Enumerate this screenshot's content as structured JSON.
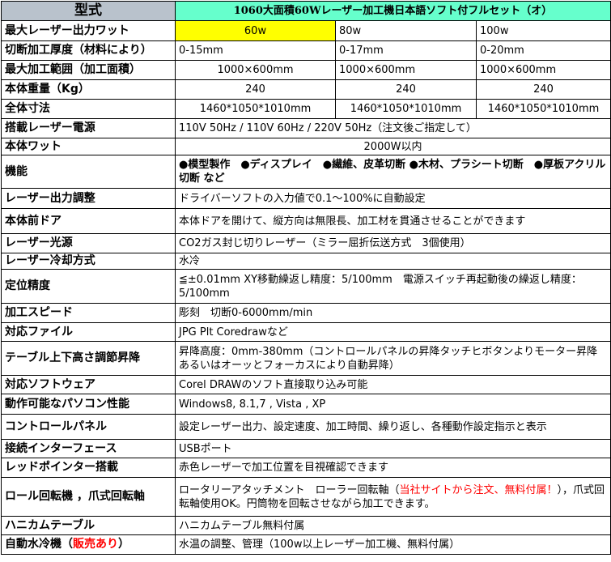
{
  "header": {
    "label": "型式",
    "title": "1060大面積60Wレーザー加工機日本語ソフト付フルセット（オ）"
  },
  "rows": {
    "power": {
      "label": "最大レーザー出力ワット",
      "v1": "60w",
      "v2": "80w",
      "v3": "100w"
    },
    "thickness": {
      "label": "切断加工厚度（材料により）",
      "v1": "0-15mm",
      "v2": "0-17mm",
      "v3": "0-20mm"
    },
    "area": {
      "label": "最大加工範囲（加工面積）",
      "v1": "1000×600mm",
      "v2": "1000×600mm",
      "v3": "1000×600mm"
    },
    "weight": {
      "label": "本体重量（Kg）",
      "v1": "240",
      "v2": "240",
      "v3": "240"
    },
    "size": {
      "label": "全体寸法",
      "v1": "1460*1050*1010mm",
      "v2": "1460*1050*1010mm",
      "v3": "1460*1050*1010mm"
    },
    "supply": {
      "label": "搭載レーザー電源",
      "value": "110V 50Hz / 110V 60Hz  / 220V 50Hz（注文後ご指定して）"
    },
    "wattage": {
      "label": "本体ワット",
      "value": "2000W以内"
    },
    "function": {
      "label": "機能",
      "value": "●模型製作　●ディスプレイ　●繊維、皮革切断 ●木材、プラシート切断　●厚板アクリル切断 など"
    },
    "adjust": {
      "label": "レーザー出力調整",
      "value": "ドライバーソフトの入力値で0.1～100%に自動設定"
    },
    "door": {
      "label": "本体前ドア",
      "value": "本体ドアを開けて、縦方向は無限長、加工材を貫通させることができます"
    },
    "source": {
      "label": "レーザー光源",
      "value": "CO2ガス封じ切りレーザー（ミラー屈折伝送方式　3個使用）"
    },
    "cooling": {
      "label": "レーザー冷却方式",
      "value": "水冷"
    },
    "precision": {
      "label": "定位精度",
      "value": "≦±0.01mm XY移動繰返し精度：5/100mm　電源スイッチ再起動後の繰返し精度：5/100mm"
    },
    "speed": {
      "label": "加工スピード",
      "value": "彫刻　切断0-6000mm/min"
    },
    "files": {
      "label": "対応ファイル",
      "value": "JPG  Plt  Coredrawなど"
    },
    "lift": {
      "label": "テーブル上下高さ調節昇降",
      "value": "昇降高度：0mm-380mm（コントロールパネルの昇降タッチヒボタンよりモーター昇降あるいはオーッとフォーカスにより自動昇降）"
    },
    "software": {
      "label": "対応ソフトウェア",
      "value": "Corel DRAWのソフト直接取り込み可能"
    },
    "pc": {
      "label": "動作可能なパソコン性能",
      "value": "Windows8, 8.1,7 , Vista , XP"
    },
    "panel": {
      "label": "コントロールパネル",
      "value": "設定レーザー出力、設定速度、加工時間、繰り返し、各種動作設定指示と表示"
    },
    "interface": {
      "label": "接続インターフェース",
      "value": "USBポート"
    },
    "pointer": {
      "label": "レッドポインター搭載",
      "value": "赤色レーザーで加工位置を目視確認できます"
    },
    "rotary": {
      "label": "ロール回転機 ，爪式回転軸",
      "value_a": "ロータリーアタッチメント　ローラー回転軸（",
      "value_red": "当社サイトから注文、無料付属！",
      "value_b": "），爪式回転軸使用OK。円筒物を回転させながら加工できます。"
    },
    "honeycomb": {
      "label": "ハニカムテーブル",
      "value": "ハニカムテーブル無料付属"
    },
    "chiller": {
      "label_a": "自動水冷機（",
      "label_red": "販売あり",
      "label_b": "）",
      "value": "水温の調整、管理（100w以上レーザー加工機、無料付属）"
    }
  },
  "colors": {
    "header_label_bg": "#b9c2cc",
    "title_bg": "#66ffcc",
    "highlight_bg": "#ffff00",
    "accent_red": "#ff0000"
  }
}
